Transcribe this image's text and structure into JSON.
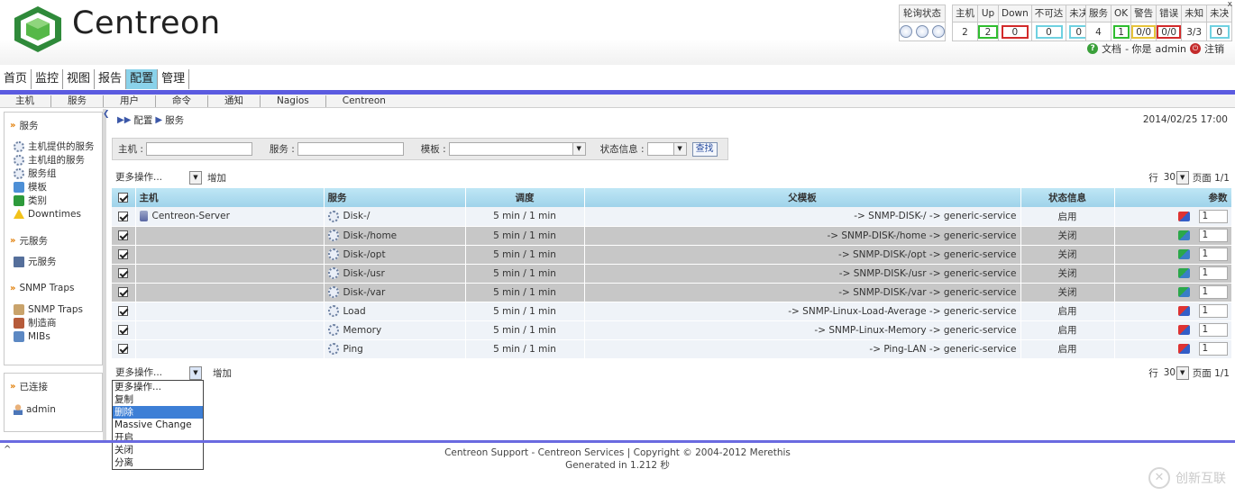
{
  "brand": {
    "name": "Centreon"
  },
  "status_bar": {
    "poll_label": "轮询状态",
    "host_headers": [
      "主机",
      "Up",
      "Down",
      "不可达",
      "未决"
    ],
    "host_values": [
      "2",
      "2",
      "0",
      "0",
      "0"
    ],
    "svc_headers": [
      "服务",
      "OK",
      "警告",
      "错误",
      "未知",
      "未决"
    ],
    "svc_values": [
      "4",
      "1",
      "0/0",
      "0/0",
      "3/3",
      "0"
    ],
    "colors": {
      "ok": "#2fbd2f",
      "critical": "#d22a2a",
      "pending": "#6fd1e1",
      "warning": "#e7c33a"
    }
  },
  "user_line": {
    "doc": "文档",
    "sep": " - 你是 ",
    "user": "admin",
    "logout": "注销"
  },
  "main_nav": [
    "首页",
    "监控",
    "视图",
    "报告",
    "配置",
    "管理"
  ],
  "sub_nav": [
    "主机",
    "服务",
    "用户",
    "命令",
    "通知",
    "Nagios",
    "Centreon"
  ],
  "sidebar": {
    "services_title": "服务",
    "services_items": [
      {
        "label": "主机提供的服务",
        "icon": "gear-icon"
      },
      {
        "label": "主机组的服务",
        "icon": "gear-icon"
      },
      {
        "label": "服务组",
        "icon": "gears-icon"
      },
      {
        "label": "模板",
        "icon": "template-icon"
      },
      {
        "label": "类别",
        "icon": "category-icon"
      },
      {
        "label": "Downtimes",
        "icon": "warning-icon"
      }
    ],
    "meta_title": "元服务",
    "meta_items": [
      {
        "label": "元服务",
        "icon": "truck-icon"
      }
    ],
    "snmp_title": "SNMP Traps",
    "snmp_items": [
      {
        "label": "SNMP Traps",
        "icon": "trap-icon"
      },
      {
        "label": "制造商",
        "icon": "vendor-icon"
      },
      {
        "label": "MIBs",
        "icon": "mib-icon"
      }
    ],
    "connected_title": "已连接",
    "connected_user": "admin"
  },
  "breadcrumb": [
    "配置",
    "服务"
  ],
  "datetime": "2014/02/25 17:00",
  "filter": {
    "host_label": "主机 :",
    "service_label": "服务 :",
    "template_label": "模板 :",
    "status_label": "状态信息 :",
    "search_button": "查找"
  },
  "toolbar": {
    "more_actions": "更多操作...",
    "add": "增加",
    "row_label": "行",
    "rows_per_page": "30",
    "page_label": "页面 1/1"
  },
  "table": {
    "headers": [
      "主机",
      "服务",
      "调度",
      "父模板",
      "状态信息",
      "参数"
    ],
    "rows": [
      {
        "host": "Centreon-Server",
        "service": "Disk-/",
        "schedule": "5 min / 1 min",
        "parent": "-> SNMP-DISK-/ -> generic-service",
        "status": "启用",
        "param": "1",
        "enabled": true
      },
      {
        "host": "",
        "service": "Disk-/home",
        "schedule": "5 min / 1 min",
        "parent": "-> SNMP-DISK-/home -> generic-service",
        "status": "关闭",
        "param": "1",
        "enabled": false
      },
      {
        "host": "",
        "service": "Disk-/opt",
        "schedule": "5 min / 1 min",
        "parent": "-> SNMP-DISK-/opt -> generic-service",
        "status": "关闭",
        "param": "1",
        "enabled": false
      },
      {
        "host": "",
        "service": "Disk-/usr",
        "schedule": "5 min / 1 min",
        "parent": "-> SNMP-DISK-/usr -> generic-service",
        "status": "关闭",
        "param": "1",
        "enabled": false
      },
      {
        "host": "",
        "service": "Disk-/var",
        "schedule": "5 min / 1 min",
        "parent": "-> SNMP-DISK-/var -> generic-service",
        "status": "关闭",
        "param": "1",
        "enabled": false
      },
      {
        "host": "",
        "service": "Load",
        "schedule": "5 min / 1 min",
        "parent": "-> SNMP-Linux-Load-Average -> generic-service",
        "status": "启用",
        "param": "1",
        "enabled": true
      },
      {
        "host": "",
        "service": "Memory",
        "schedule": "5 min / 1 min",
        "parent": "-> SNMP-Linux-Memory -> generic-service",
        "status": "启用",
        "param": "1",
        "enabled": true
      },
      {
        "host": "",
        "service": "Ping",
        "schedule": "5 min / 1 min",
        "parent": "-> Ping-LAN -> generic-service",
        "status": "启用",
        "param": "1",
        "enabled": true
      }
    ]
  },
  "dropdown_options": [
    "更多操作...",
    "复制",
    "删除",
    "Massive Change",
    "开启",
    "关闭",
    "分离"
  ],
  "dropdown_selected_index": 2,
  "footer": {
    "line1": "Centreon Support - Centreon Services | Copyright © 2004-2012 Merethis",
    "line2": "Generated in 1.212 秒"
  },
  "watermark": "创新互联"
}
